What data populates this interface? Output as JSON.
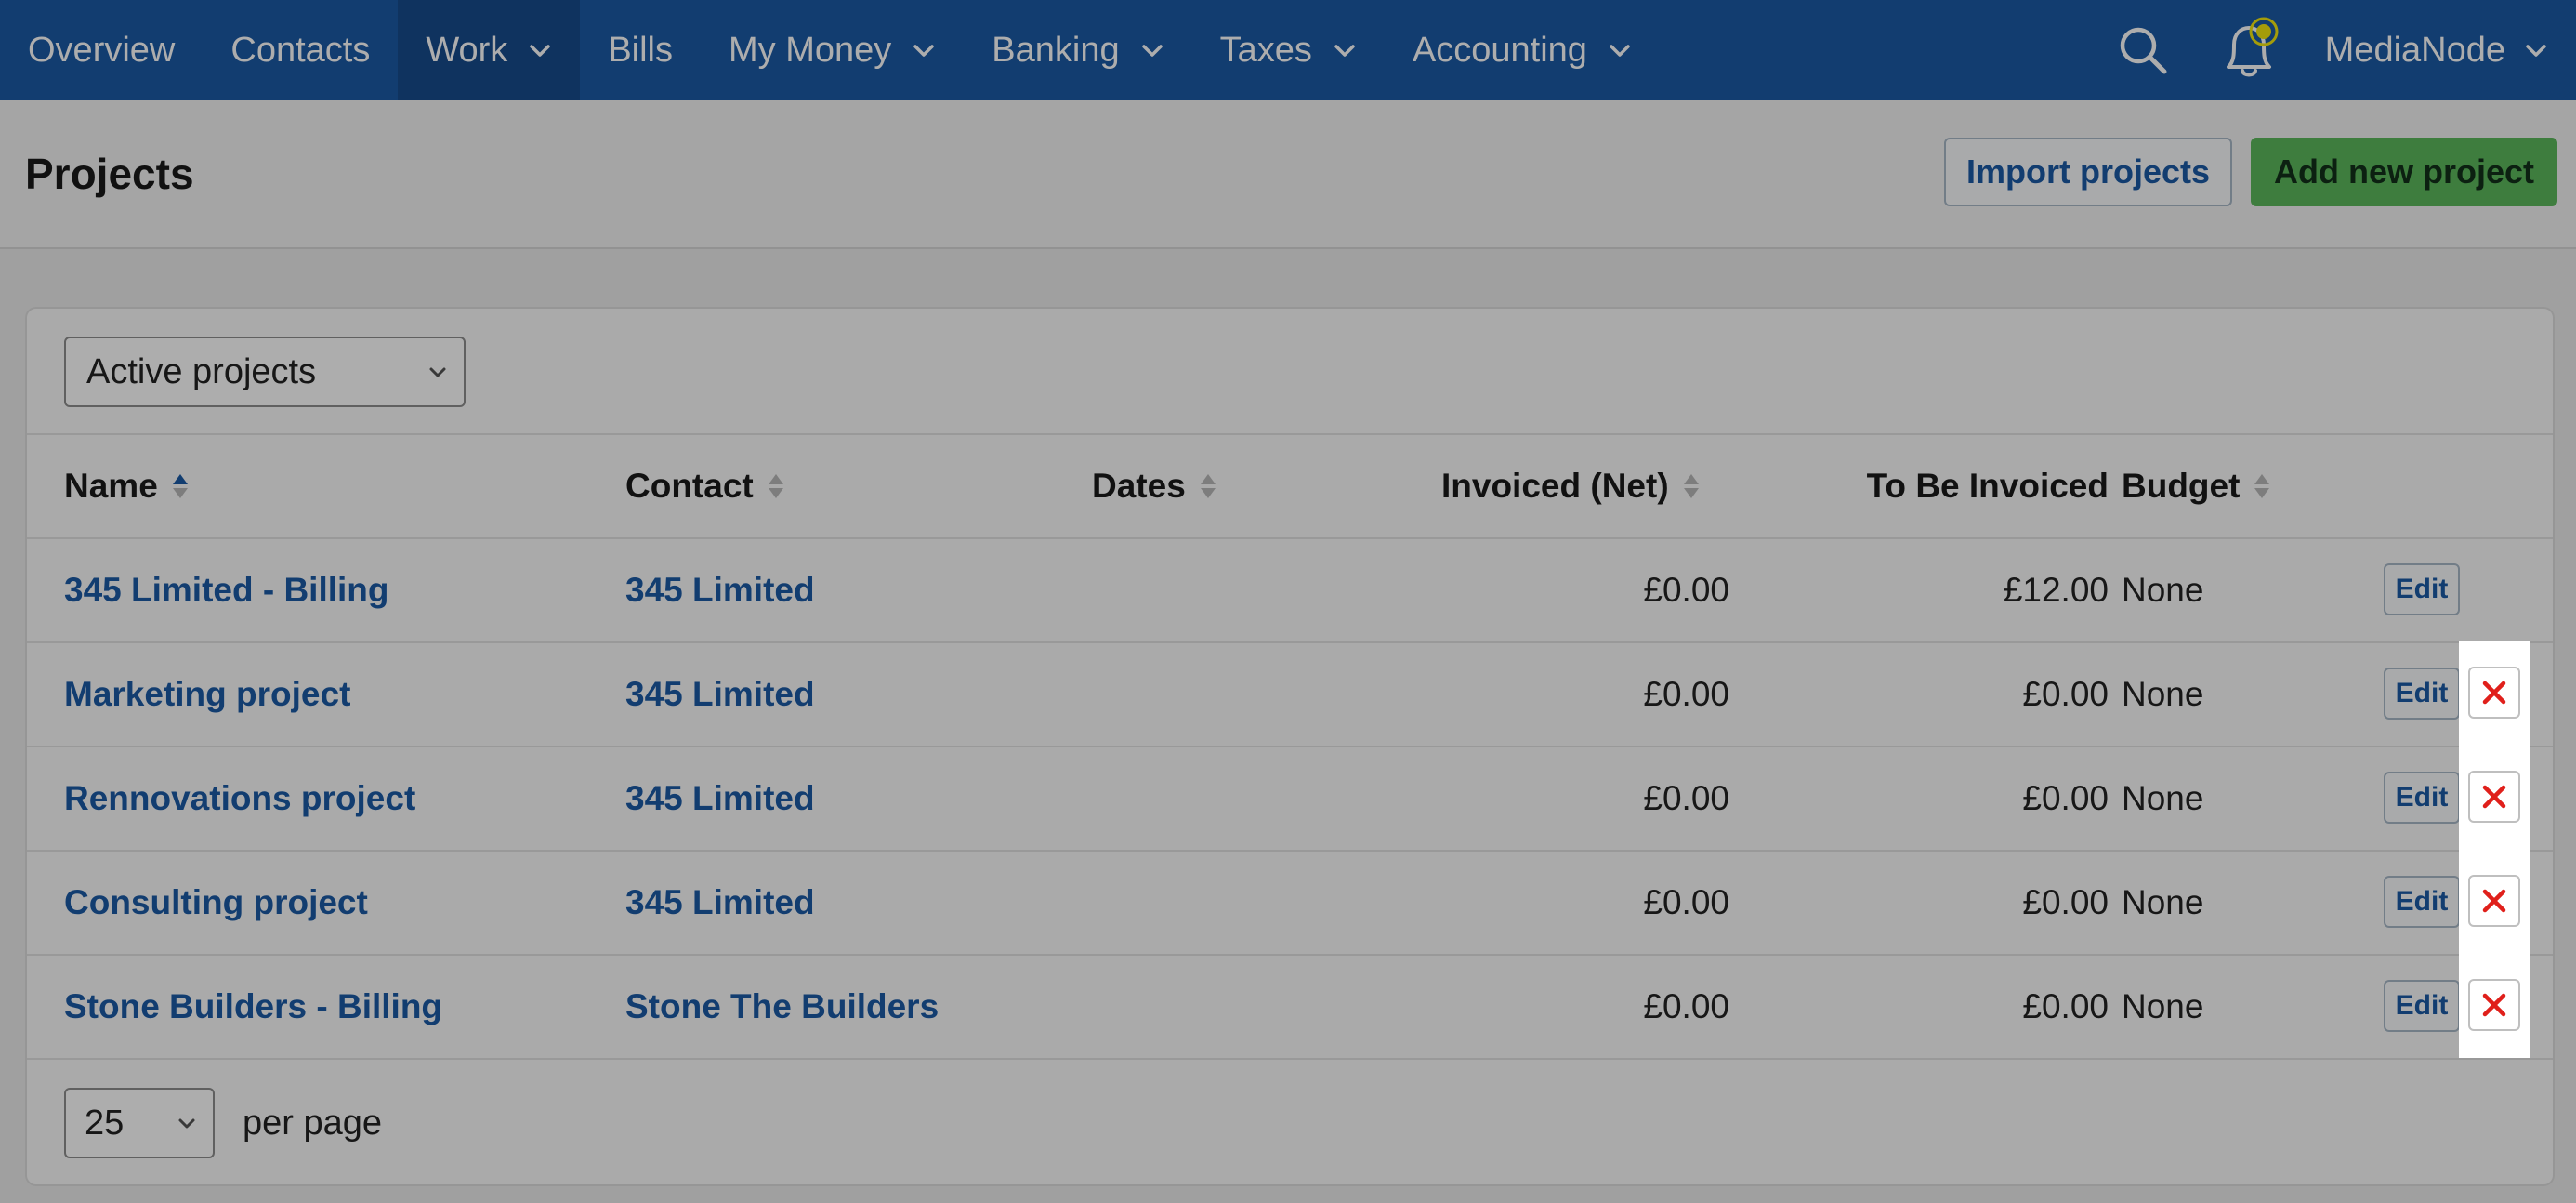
{
  "nav": {
    "items": [
      {
        "label": "Overview",
        "dropdown": false,
        "active": false
      },
      {
        "label": "Contacts",
        "dropdown": false,
        "active": false
      },
      {
        "label": "Work",
        "dropdown": true,
        "active": true
      },
      {
        "label": "Bills",
        "dropdown": false,
        "active": false
      },
      {
        "label": "My Money",
        "dropdown": true,
        "active": false
      },
      {
        "label": "Banking",
        "dropdown": true,
        "active": false
      },
      {
        "label": "Taxes",
        "dropdown": true,
        "active": false
      },
      {
        "label": "Accounting",
        "dropdown": true,
        "active": false
      }
    ],
    "user": "MediaNode",
    "search_icon": "search-icon",
    "notification_icon": "bell-icon"
  },
  "header": {
    "title": "Projects",
    "import_label": "Import projects",
    "add_label": "Add new project"
  },
  "filter": {
    "selected": "Active projects"
  },
  "table": {
    "columns": {
      "name": "Name",
      "contact": "Contact",
      "dates": "Dates",
      "invoiced": "Invoiced (Net)",
      "to_be_invoiced": "To Be Invoiced",
      "budget": "Budget"
    },
    "rows": [
      {
        "name": "345 Limited - Billing",
        "contact": "345 Limited",
        "dates": "",
        "invoiced": "£0.00",
        "to_be_invoiced": "£12.00",
        "budget": "None",
        "edit": "Edit",
        "deletable": false
      },
      {
        "name": "Marketing project",
        "contact": "345 Limited",
        "dates": "",
        "invoiced": "£0.00",
        "to_be_invoiced": "£0.00",
        "budget": "None",
        "edit": "Edit",
        "deletable": true
      },
      {
        "name": "Rennovations project",
        "contact": "345 Limited",
        "dates": "",
        "invoiced": "£0.00",
        "to_be_invoiced": "£0.00",
        "budget": "None",
        "edit": "Edit",
        "deletable": true
      },
      {
        "name": "Consulting project",
        "contact": "345 Limited",
        "dates": "",
        "invoiced": "£0.00",
        "to_be_invoiced": "£0.00",
        "budget": "None",
        "edit": "Edit",
        "deletable": true
      },
      {
        "name": "Stone Builders - Billing",
        "contact": "Stone The Builders",
        "dates": "",
        "invoiced": "£0.00",
        "to_be_invoiced": "£0.00",
        "budget": "None",
        "edit": "Edit",
        "deletable": true
      }
    ]
  },
  "pagination": {
    "per_page_value": "25",
    "per_page_label": "per page"
  },
  "colors": {
    "nav_bg": "#1b5aa6",
    "link": "#1b5aa6",
    "add_button": "#5cb85c",
    "delete_x": "#e0201b",
    "notification_dot": "#f2e60f"
  }
}
